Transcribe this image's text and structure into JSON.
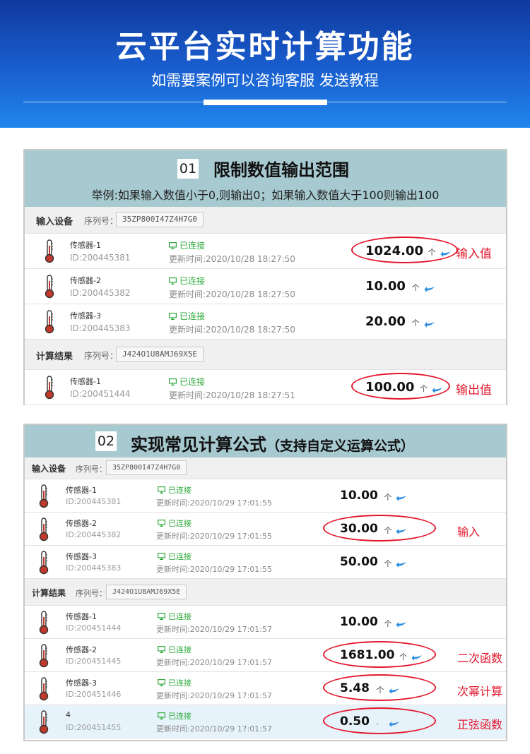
{
  "header": {
    "title": "云平台实时计算功能",
    "subtitle": "如需要案例可以咨询客服 发送教程"
  },
  "panel1": {
    "number": "01",
    "title": "限制数值输出范围",
    "description": "举例:如果输入数值小于0,则输出0；如果输入数值大于100则输出100",
    "input_section": {
      "label": "输入设备",
      "serial_label": "序列号：",
      "serial": "35ZP800I47Z4H7G0"
    },
    "output_section": {
      "label": "计算结果",
      "serial_label": "序列号：",
      "serial": "J424O1U8AMJ69X5E"
    },
    "inputs": [
      {
        "name": "传感器-1",
        "id": "ID:200445381",
        "status": "已连接",
        "time": "更新时间:2020/10/28 18:27:50",
        "value": "1024.00",
        "up": "个",
        "note": "输入值"
      },
      {
        "name": "传感器-2",
        "id": "ID:200445382",
        "status": "已连接",
        "time": "更新时间:2020/10/28 18:27:50",
        "value": "10.00",
        "up": "个"
      },
      {
        "name": "传感器-3",
        "id": "ID:200445383",
        "status": "已连接",
        "time": "更新时间:2020/10/28 18:27:50",
        "value": "20.00",
        "up": "个"
      }
    ],
    "outputs": [
      {
        "name": "传感器-1",
        "id": "ID:200451444",
        "status": "已连接",
        "time": "更新时间:2020/10/28 18:27:51",
        "value": "100.00",
        "up": "个",
        "note": "输出值"
      }
    ]
  },
  "panel2": {
    "number": "02",
    "title": "实现常见计算公式",
    "title_paren": "（支持自定义运算公式）",
    "input_section": {
      "label": "输入设备",
      "serial_label": "序列号：",
      "serial": "35ZP800I47Z4H7G0"
    },
    "output_section": {
      "label": "计算结果",
      "serial_label": "序列号：",
      "serial": "J424O1U8AMJ69X5E"
    },
    "inputs": [
      {
        "name": "传感器-1",
        "id": "ID:200445381",
        "status": "已连接",
        "time": "更新时间:2020/10/29 17:01:55",
        "value": "10.00",
        "up": "个"
      },
      {
        "name": "传感器-2",
        "id": "ID:200445382",
        "status": "已连接",
        "time": "更新时间:2020/10/29 17:01:55",
        "value": "30.00",
        "up": "个",
        "note": "输入"
      },
      {
        "name": "传感器-3",
        "id": "ID:200445383",
        "status": "已连接",
        "time": "更新时间:2020/10/29 17:01:55",
        "value": "50.00",
        "up": "个"
      }
    ],
    "outputs": [
      {
        "name": "传感器-1",
        "id": "ID:200451444",
        "status": "已连接",
        "time": "更新时间:2020/10/29 17:01:57",
        "value": "10.00",
        "up": "个"
      },
      {
        "name": "传感器-2",
        "id": "ID:200451445",
        "status": "已连接",
        "time": "更新时间:2020/10/29 17:01:57",
        "value": "1681.00",
        "up": "个",
        "note": "二次函数"
      },
      {
        "name": "传感器-3",
        "id": "ID:200451446",
        "status": "已连接",
        "time": "更新时间:2020/10/29 17:01:57",
        "value": "5.48",
        "up": "个",
        "note": "次幂计算"
      },
      {
        "name": "4",
        "id": "ID:200451455",
        "status": "已连接",
        "time": "更新时间:2020/10/29 17:01:57",
        "value": "0.50",
        "up": ".",
        "note": "正弦函数"
      }
    ]
  },
  "colors": {
    "accent_red": "#e3172c",
    "connected_green": "#2faa3c",
    "arrow_blue": "#2d8de0",
    "header_teal": "#a7c9d0"
  },
  "icons": {
    "device": "thermometer-icon",
    "status": "monitor-icon",
    "refresh": "arrow-left-icon"
  }
}
